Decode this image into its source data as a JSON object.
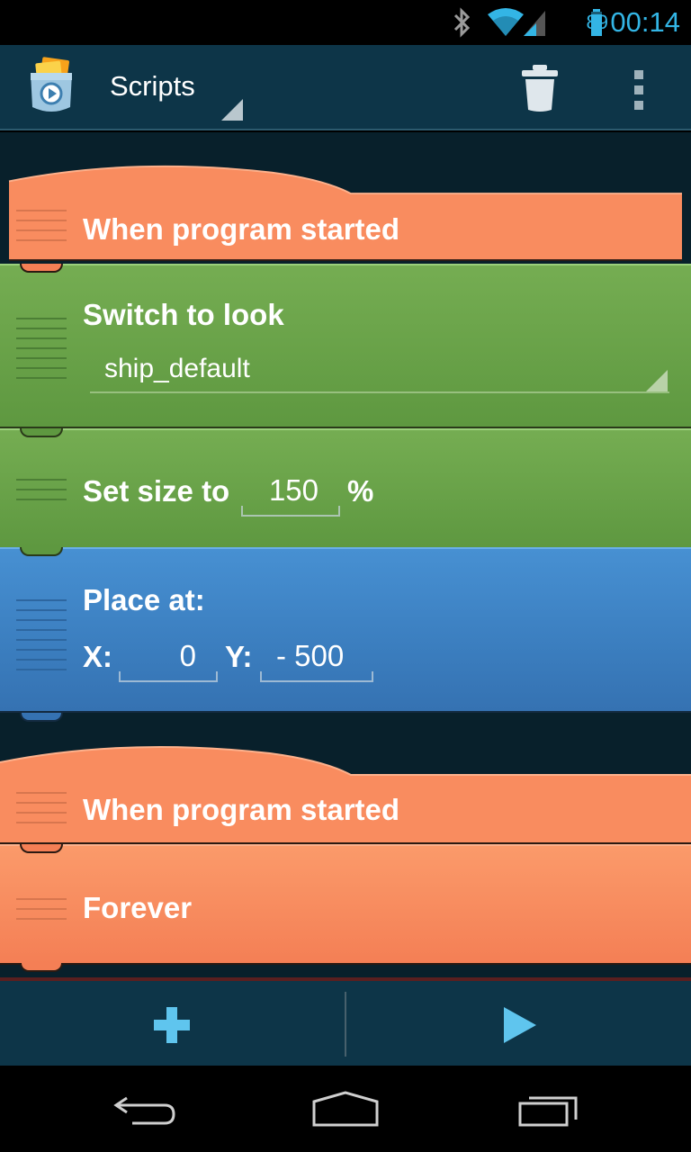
{
  "status_bar": {
    "time": "00:14",
    "battery_percent": "89",
    "icons": [
      "bluetooth-icon",
      "wifi-icon",
      "signal-icon",
      "battery-icon"
    ]
  },
  "action_bar": {
    "title": "Scripts",
    "icons": [
      "catroid-pocket-code-icon",
      "trash-icon",
      "overflow-menu-icon"
    ]
  },
  "script": {
    "bricks": [
      {
        "type": "when-program-started",
        "label": "When program started"
      },
      {
        "type": "switch-to-look",
        "label": "Switch to look",
        "look_value": "ship_default"
      },
      {
        "type": "set-size",
        "label": "Set size to",
        "value": "150",
        "unit": "%"
      },
      {
        "type": "place-at",
        "label": "Place at:",
        "x_label": "X:",
        "x_value": "0",
        "y_label": "Y:",
        "y_value": "- 500"
      },
      {
        "type": "when-program-started",
        "label": "When program started"
      },
      {
        "type": "forever",
        "label": "Forever"
      }
    ]
  },
  "bottom_bar": {
    "icons": [
      "add-icon",
      "play-icon"
    ]
  },
  "nav_bar": {
    "icons": [
      "back-icon",
      "home-icon",
      "recent-apps-icon"
    ]
  },
  "colors": {
    "action_bar": "#0d3548",
    "script_background": "#08202b",
    "event_brick": "#f98c5f",
    "look_brick": "#6aa34a",
    "motion_brick": "#3f85c9",
    "status_accent": "#33b5e5"
  }
}
